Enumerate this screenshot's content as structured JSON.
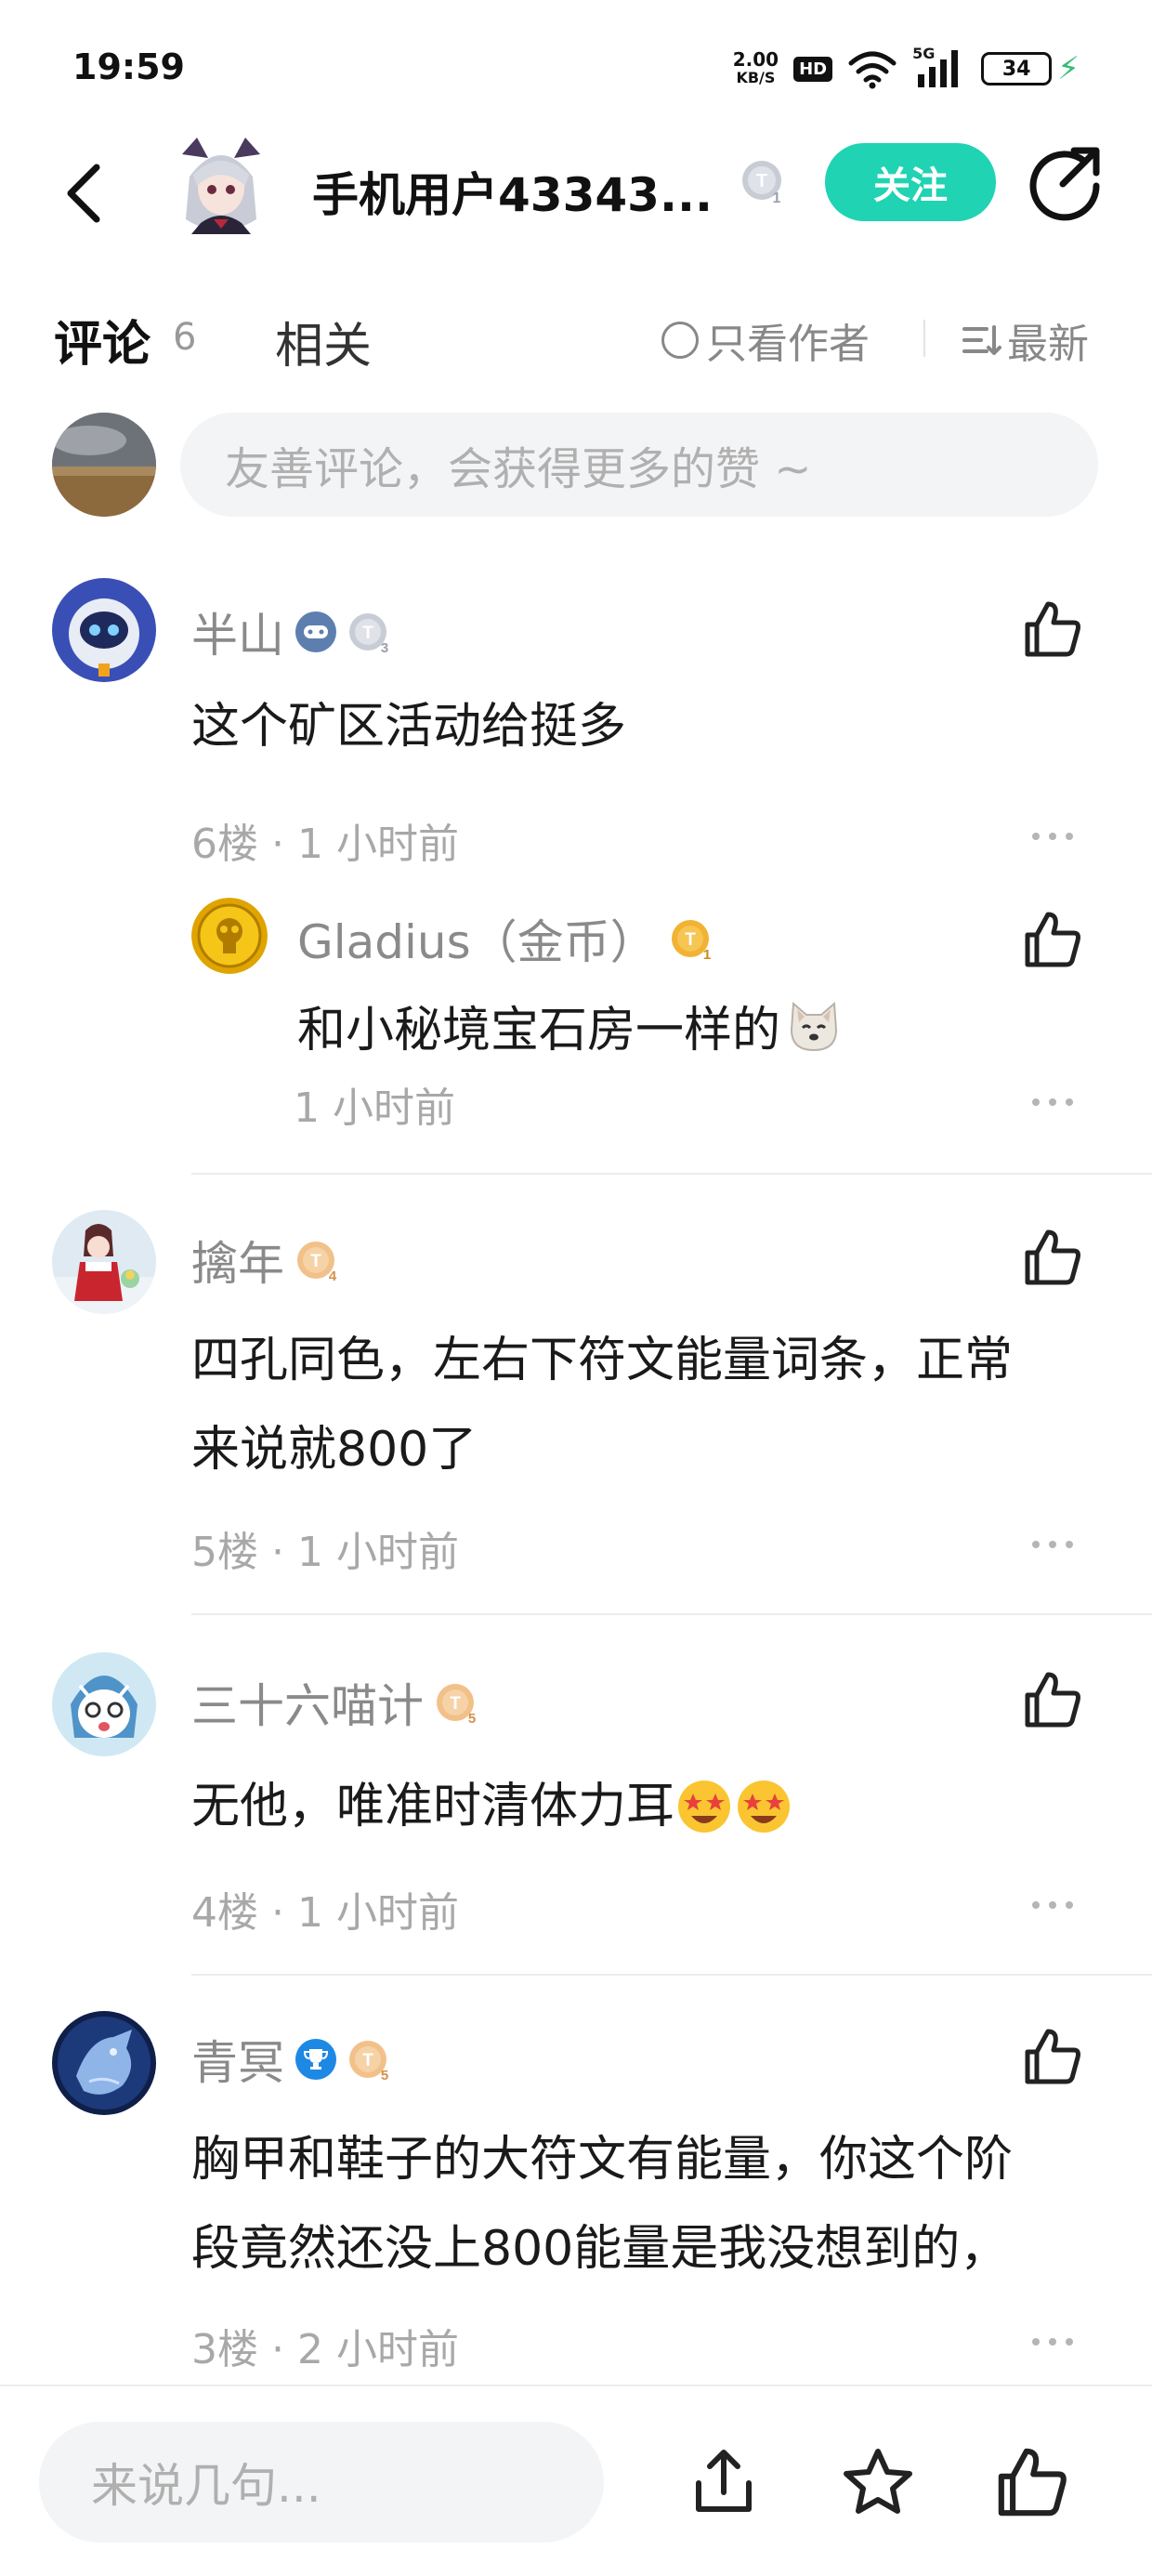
{
  "status_bar": {
    "time": "19:59",
    "net_speed_value": "2.00",
    "net_speed_unit": "KB/S",
    "hd": "HD",
    "signal_label": "5G",
    "battery": "34"
  },
  "header": {
    "title": "手机用户43343...",
    "follow_label": "关注"
  },
  "tabs": {
    "comments_label": "评论",
    "comments_count": "6",
    "related_label": "相关",
    "author_only_label": "只看作者",
    "sort_label": "最新"
  },
  "compose": {
    "placeholder": "友善评论，会获得更多的赞 ~"
  },
  "comments": [
    {
      "name": "半山",
      "badges": [
        "gamepad-badge",
        "T3"
      ],
      "text": "这个矿区活动给挺多",
      "floor": "6楼",
      "time": "1 小时前",
      "reply": {
        "name": "Gladius（金币）",
        "badge": "T1",
        "text": "和小秘境宝石房一样的",
        "emoji": "dog-face-emoji",
        "time": "1 小时前"
      }
    },
    {
      "name": "擒年",
      "badges": [
        "T4"
      ],
      "text_line1": "四孔同色，左右下符文能量词条，正常",
      "text_line2": "来说就800了",
      "floor": "5楼",
      "time": "1 小时前"
    },
    {
      "name": "三十六喵计",
      "badges": [
        "T5"
      ],
      "text": "无他，唯准时清体力耳",
      "emoji": "star-struck-emoji",
      "floor": "4楼",
      "time": "1 小时前"
    },
    {
      "name": "青冥",
      "badges": [
        "trophy-badge",
        "T5"
      ],
      "text_line1": "胸甲和鞋子的大符文有能量，你这个阶",
      "text_line2": "段竟然还没上800能量是我没想到的，",
      "floor": "3楼",
      "time": "2 小时前"
    }
  ],
  "separator": "·",
  "bottom_bar": {
    "placeholder": "来说几句..."
  },
  "colors": {
    "accent": "#1fd3b3",
    "tab_underline": "#38d9b9",
    "muted_text": "#8a8a8a",
    "input_bg": "#f3f4f6"
  }
}
